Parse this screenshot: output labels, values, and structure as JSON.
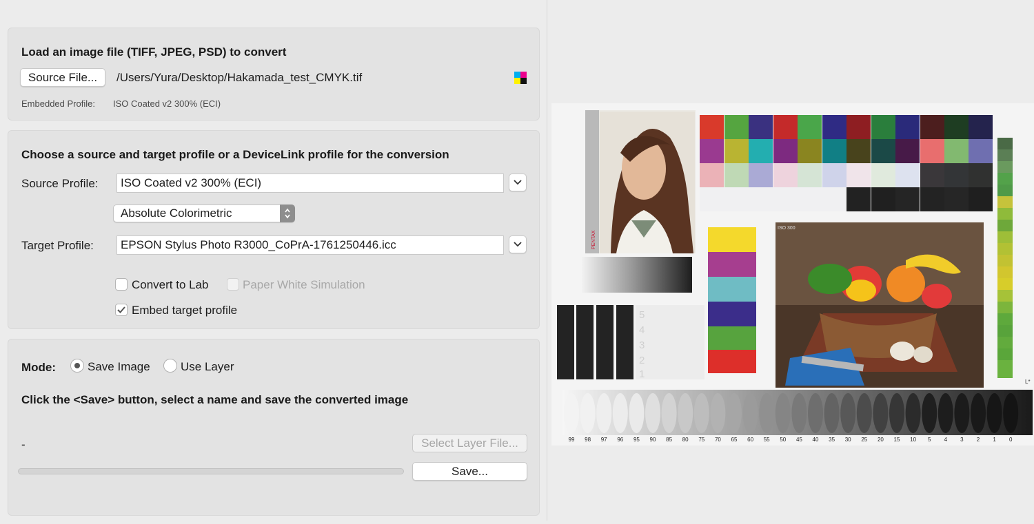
{
  "load_section": {
    "heading": "Load an image file (TIFF, JPEG, PSD) to convert",
    "source_button": "Source File...",
    "file_path": "/Users/Yura/Desktop/Hakamada_test_CMYK.tif",
    "embedded_label": "Embedded Profile:",
    "embedded_value": "ISO Coated v2 300% (ECI)",
    "cmyk_icon_colors": [
      "#00aeef",
      "#ec008c",
      "#fff200",
      "#111111"
    ]
  },
  "profile_section": {
    "heading": "Choose a source and target profile or a DeviceLink profile for the conversion",
    "source_label": "Source Profile:",
    "source_value": "ISO Coated v2 300% (ECI)",
    "intent_value": "Absolute Colorimetric",
    "target_label": "Target Profile:",
    "target_value": "EPSON Stylus Photo R3000_CoPrA-1761250446.icc",
    "convert_lab_label": "Convert to Lab",
    "convert_lab_checked": false,
    "paper_white_label": "Paper White Simulation",
    "paper_white_enabled": false,
    "embed_label": "Embed target profile",
    "embed_checked": true
  },
  "save_section": {
    "mode_label": "Mode:",
    "save_image_label": "Save Image",
    "use_layer_label": "Use Layer",
    "selected_mode": "Save Image",
    "instruction": "Click the <Save> button, select a name and save the converted image",
    "status": "-",
    "select_layer_button": "Select Layer File...",
    "save_button": "Save...",
    "progress_percent": 0
  },
  "preview": {
    "portrait_brand": "PENTAX",
    "photo_label": "ISO 300",
    "step_labels": [
      "99",
      "98",
      "97",
      "96",
      "95",
      "90",
      "85",
      "80",
      "75",
      "70",
      "65",
      "60",
      "55",
      "50",
      "45",
      "40",
      "35",
      "30",
      "25",
      "20",
      "15",
      "10",
      "5",
      "4",
      "3",
      "2",
      "1",
      "0"
    ],
    "side_digits": [
      "5",
      "4",
      "3",
      "2",
      "1"
    ],
    "corner_label": "L*"
  }
}
